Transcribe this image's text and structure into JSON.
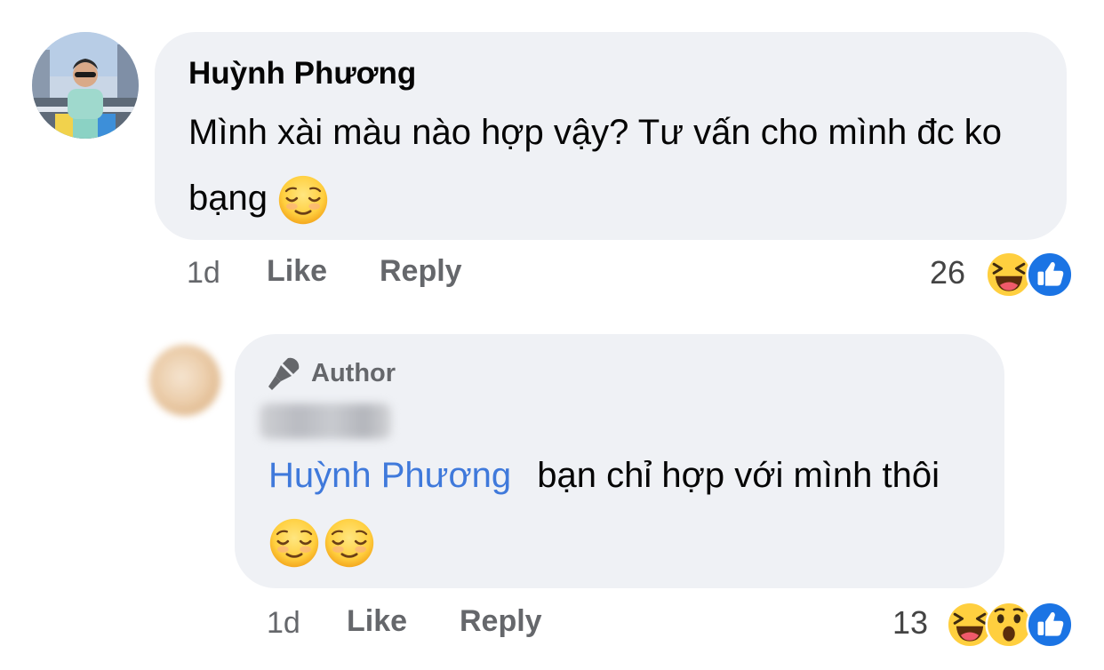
{
  "comments": [
    {
      "author": "Huỳnh Phương",
      "text": "Mình xài màu nào hợp vậy? Tư vấn cho mình đc ko bạng",
      "time": "1d",
      "like_label": "Like",
      "reply_label": "Reply",
      "reaction_count": "26",
      "reactions": [
        "haha-icon",
        "like-icon"
      ]
    }
  ],
  "reply": {
    "badge_label": "Author",
    "mention": "Huỳnh Phương",
    "text": "bạn chỉ hợp với mình thôi",
    "time": "1d",
    "like_label": "Like",
    "reply_label": "Reply",
    "reaction_count": "13",
    "reactions": [
      "haha-icon",
      "wow-icon",
      "like-icon"
    ]
  },
  "colors": {
    "bubble": "#eff1f5",
    "meta_text": "#65676b",
    "mention": "#3f79db",
    "like_blue": "#1b74e4",
    "emoji_yellow": "#ffcf3f"
  }
}
